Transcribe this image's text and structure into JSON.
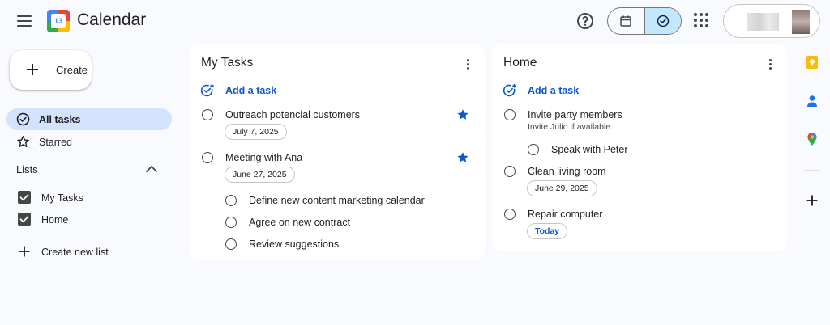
{
  "header": {
    "app_title": "Calendar",
    "logo_day": "13"
  },
  "sidebar": {
    "create_label": "Create",
    "nav": [
      {
        "label": "All tasks",
        "icon": "check-circle-icon",
        "active": true
      },
      {
        "label": "Starred",
        "icon": "star-outline-icon",
        "active": false
      }
    ],
    "lists_header": "Lists",
    "lists": [
      {
        "label": "My Tasks",
        "checked": true
      },
      {
        "label": "Home",
        "checked": true
      }
    ],
    "create_list_label": "Create new list"
  },
  "cards": [
    {
      "title": "My Tasks",
      "add_task_label": "Add a task",
      "tasks": [
        {
          "title": "Outreach potencial customers",
          "date": "July 7, 2025",
          "starred": true
        },
        {
          "title": "Meeting with Ana",
          "date": "June 27, 2025",
          "starred": true,
          "subtasks": [
            "Define new content marketing calendar",
            "Agree on new contract",
            "Review suggestions"
          ]
        }
      ]
    },
    {
      "title": "Home",
      "add_task_label": "Add a task",
      "tasks": [
        {
          "title": "Invite party members",
          "description": "Invite Julio if available",
          "subtasks": [
            "Speak with Peter"
          ]
        },
        {
          "title": "Clean living room",
          "date": "June 29, 2025"
        },
        {
          "title": "Repair computer",
          "date": "Today"
        }
      ]
    }
  ],
  "colors": {
    "accent": "#0b57d0",
    "active_nav": "#d3e3fd",
    "toggle_active": "#c2e7ff",
    "background": "#f8fafd"
  }
}
